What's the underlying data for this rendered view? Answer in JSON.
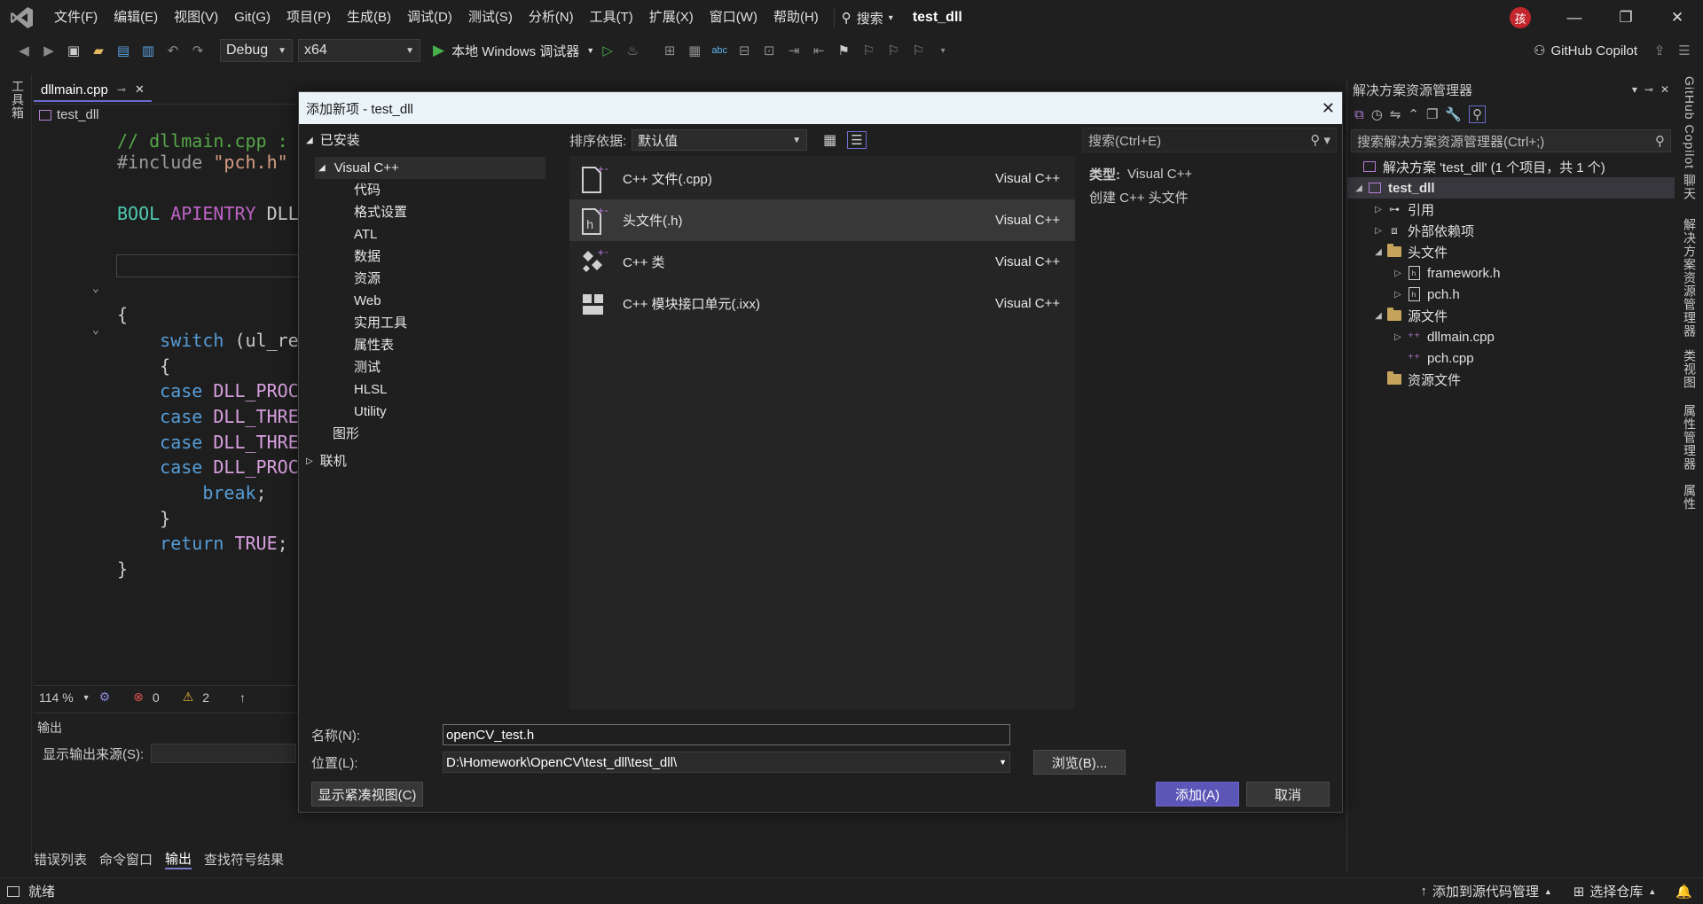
{
  "menubar": {
    "items": [
      "文件(F)",
      "编辑(E)",
      "视图(V)",
      "Git(G)",
      "项目(P)",
      "生成(B)",
      "调试(D)",
      "测试(S)",
      "分析(N)",
      "工具(T)",
      "扩展(X)",
      "窗口(W)",
      "帮助(H)"
    ],
    "search_label": "搜索",
    "solution_name": "test_dll",
    "avatar_initial": "孩"
  },
  "toolbar": {
    "config": "Debug",
    "platform": "x64",
    "run_label": "本地 Windows 调试器",
    "copilot_label": "GitHub Copilot"
  },
  "left_strip": {
    "toolbox_label": "工具箱"
  },
  "editor": {
    "tab_name": "dllmain.cpp",
    "nav_project": "test_dll",
    "lines": [
      {
        "text": "// dllmain.cpp :",
        "kind": "c-comment"
      },
      {
        "text": "#include \"pch.h\"",
        "kind": "c-pre"
      },
      {
        "text": "BOOL APIENTRY DLL",
        "kind": "c-type"
      },
      {
        "text": "{",
        "kind": "c-ident"
      },
      {
        "text": "    switch (ul_re",
        "kind": "c-kw"
      },
      {
        "text": "    {",
        "kind": "c-ident"
      },
      {
        "text": "    case DLL_PROC",
        "kind": "c-kw"
      },
      {
        "text": "    case DLL_THRE",
        "kind": "c-kw"
      },
      {
        "text": "    case DLL_THRE",
        "kind": "c-kw"
      },
      {
        "text": "    case DLL_PROC",
        "kind": "c-kw"
      },
      {
        "text": "        break;",
        "kind": "c-kw"
      },
      {
        "text": "    }",
        "kind": "c-ident"
      },
      {
        "text": "    return TRUE;",
        "kind": "c-kw"
      },
      {
        "text": "}",
        "kind": "c-ident"
      }
    ],
    "zoom": "114 %",
    "errors": "0",
    "warnings": "2"
  },
  "output": {
    "title": "输出",
    "source_label": "显示输出来源(S):"
  },
  "bottom_tabs": [
    "错误列表",
    "命令窗口",
    "输出",
    "查找符号结果"
  ],
  "statusbar": {
    "ready": "就绪",
    "add_source_control": "添加到源代码管理",
    "select_repo": "选择仓库"
  },
  "solution_explorer": {
    "title": "解决方案资源管理器",
    "search_placeholder": "搜索解决方案资源管理器(Ctrl+;)",
    "solution_line": "解决方案 'test_dll' (1 个项目，共 1 个)",
    "project": "test_dll",
    "nodes": [
      "引用",
      "外部依赖项",
      "头文件",
      "framework.h",
      "pch.h",
      "源文件",
      "dllmain.cpp",
      "pch.cpp",
      "资源文件"
    ]
  },
  "right_strip": {
    "tabs": [
      "GitHub Copilot 聊天",
      "解决方案资源管理器",
      "类视图",
      "属性管理器",
      "属性"
    ]
  },
  "dialog": {
    "title": "添加新项 - test_dll",
    "installed_label": "已安装",
    "categories": {
      "root": "Visual C++",
      "children": [
        "代码",
        "格式设置",
        "ATL",
        "数据",
        "资源",
        "Web",
        "实用工具",
        "属性表",
        "测试",
        "HLSL",
        "Utility"
      ],
      "graphics": "图形"
    },
    "online_label": "联机",
    "sort_label": "排序依据:",
    "sort_value": "默认值",
    "items": [
      {
        "name": "C++ 文件(.cpp)",
        "lang": "Visual C++"
      },
      {
        "name": "头文件(.h)",
        "lang": "Visual C++"
      },
      {
        "name": "C++ 类",
        "lang": "Visual C++"
      },
      {
        "name": "C++ 模块接口单元(.ixx)",
        "lang": "Visual C++"
      }
    ],
    "search_placeholder": "搜索(Ctrl+E)",
    "detail_type_label": "类型:",
    "detail_type_value": "Visual C++",
    "detail_desc": "创建 C++ 头文件",
    "name_label": "名称(N):",
    "name_value": "openCV_test.h",
    "location_label": "位置(L):",
    "location_value": "D:\\Homework\\OpenCV\\test_dll\\test_dll\\",
    "browse_label": "浏览(B)...",
    "compact_view_label": "显示紧凑视图(C)",
    "add_label": "添加(A)",
    "cancel_label": "取消"
  },
  "colors": {
    "accent": "#5b56b8",
    "background": "#1f1f1f",
    "dialog_title_bg": "#eaf4f8"
  }
}
